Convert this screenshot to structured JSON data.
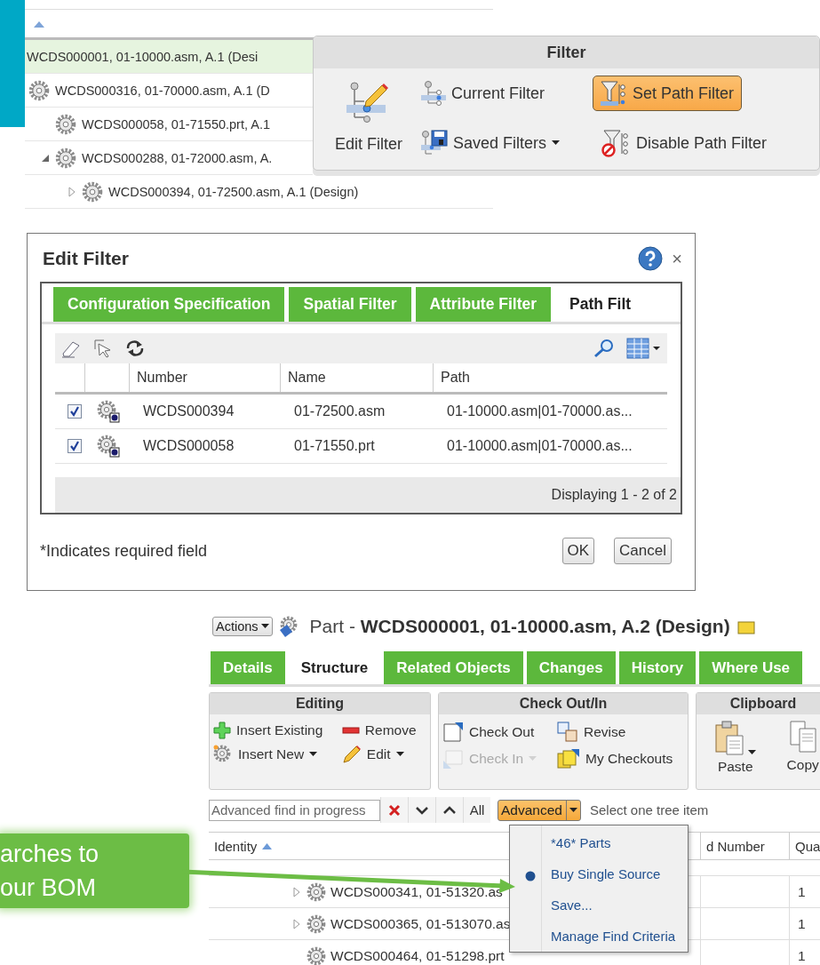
{
  "tree": {
    "nodes": [
      {
        "label": "WCDS000001, 01-10000.asm, A.1 (Desi",
        "selected": true,
        "children": [
          {
            "label": "WCDS000316, 01-70000.asm, A.1 (D",
            "selected": false,
            "children": [
              {
                "label": "WCDS000058, 01-71550.prt, A.1",
                "selected": false
              },
              {
                "label": "WCDS000288, 01-72000.asm, A.",
                "selected": false,
                "expanded": true,
                "children": [
                  {
                    "label": "WCDS000394, 01-72500.asm, A.1 (Design)",
                    "selected": false,
                    "expanded": false
                  }
                ]
              }
            ]
          }
        ]
      }
    ]
  },
  "filter_ribbon": {
    "title": "Filter",
    "edit_filter": {
      "label": "Edit Filter",
      "selected": false,
      "dropdown": false
    },
    "buttons": [
      {
        "label": "Current Filter",
        "selected": false,
        "dropdown": false
      },
      {
        "label": "Set Path Filter",
        "selected": true,
        "dropdown": false
      },
      {
        "label": "Saved Filters",
        "selected": false,
        "dropdown": true
      },
      {
        "label": "Disable Path Filter",
        "selected": false,
        "dropdown": false
      }
    ]
  },
  "edit_filter_dialog": {
    "title": "Edit Filter",
    "close": "×",
    "tabs": [
      {
        "label": "Configuration Specification",
        "selected": false
      },
      {
        "label": "Spatial Filter",
        "selected": false
      },
      {
        "label": "Attribute Filter",
        "selected": false
      },
      {
        "label": "Path Filt",
        "selected": true
      }
    ],
    "table": {
      "columns": [
        "Number",
        "Name",
        "Path"
      ],
      "rows": [
        {
          "checked": true,
          "number": "WCDS000394",
          "name": "01-72500.asm",
          "path": "01-10000.asm|01-70000.as..."
        },
        {
          "checked": true,
          "number": "WCDS000058",
          "name": "01-71550.prt",
          "path": "01-10000.asm|01-70000.as..."
        }
      ],
      "footer": "Displaying 1 - 2 of 2"
    },
    "note": "*Indicates required field",
    "buttons": [
      "OK",
      "Cancel"
    ]
  },
  "part_page": {
    "actions": "Actions",
    "heading": "Part - **WCDS000001, 01-10000.asm, A.2 (Design)**",
    "tabs": [
      {
        "label": "Details",
        "selected": false
      },
      {
        "label": "Structure",
        "selected": true
      },
      {
        "label": "Related Objects",
        "selected": false
      },
      {
        "label": "Changes",
        "selected": false
      },
      {
        "label": "History",
        "selected": false
      },
      {
        "label": "Where Use",
        "selected": false
      }
    ],
    "groups": [
      {
        "title": "Editing",
        "items": [
          {
            "label": "Insert Existing",
            "disabled": false,
            "dropdown": false
          },
          {
            "label": "Remove",
            "disabled": false,
            "dropdown": false
          },
          {
            "label": "Insert New",
            "disabled": false,
            "dropdown": true
          },
          {
            "label": "Edit",
            "disabled": false,
            "dropdown": true
          }
        ]
      },
      {
        "title": "Check Out/In",
        "items": [
          {
            "label": "Check Out",
            "disabled": false,
            "dropdown": false
          },
          {
            "label": "Revise",
            "disabled": false,
            "dropdown": false
          },
          {
            "label": "Check In",
            "disabled": true,
            "dropdown": true
          },
          {
            "label": "My Checkouts",
            "disabled": false,
            "dropdown": false
          }
        ]
      },
      {
        "title": "Clipboard",
        "items": [
          {
            "label": "Paste",
            "disabled": false,
            "dropdown": true
          },
          {
            "label": "Copy",
            "disabled": false,
            "dropdown": false
          }
        ]
      }
    ],
    "find_bar": {
      "value": "Advanced find in progress",
      "all": "All",
      "advanced": {
        "label": "Advanced",
        "active": true
      },
      "hint": "Select one tree item"
    },
    "table": {
      "columns": [
        "Identity",
        "d Number",
        "Qua"
      ],
      "rows": [
        {
          "identity": "WCDS000341, 01-51320.as",
          "expanded": false,
          "quantity": "1"
        },
        {
          "identity": "WCDS000365, 01-513070.as",
          "expanded": false,
          "quantity": "1"
        },
        {
          "identity": "WCDS000464, 01-51298.prt",
          "quantity": "1"
        }
      ]
    }
  },
  "advanced_menu": {
    "items": [
      {
        "label": "*46* Parts",
        "selected": false
      },
      {
        "label": "Buy Single Source",
        "selected": true
      },
      {
        "label": "Save...",
        "selected": false
      },
      {
        "label": "Manage Find Criteria",
        "selected": false
      }
    ]
  },
  "callout": {
    "lines": [
      "arches to",
      "our BOM"
    ]
  }
}
